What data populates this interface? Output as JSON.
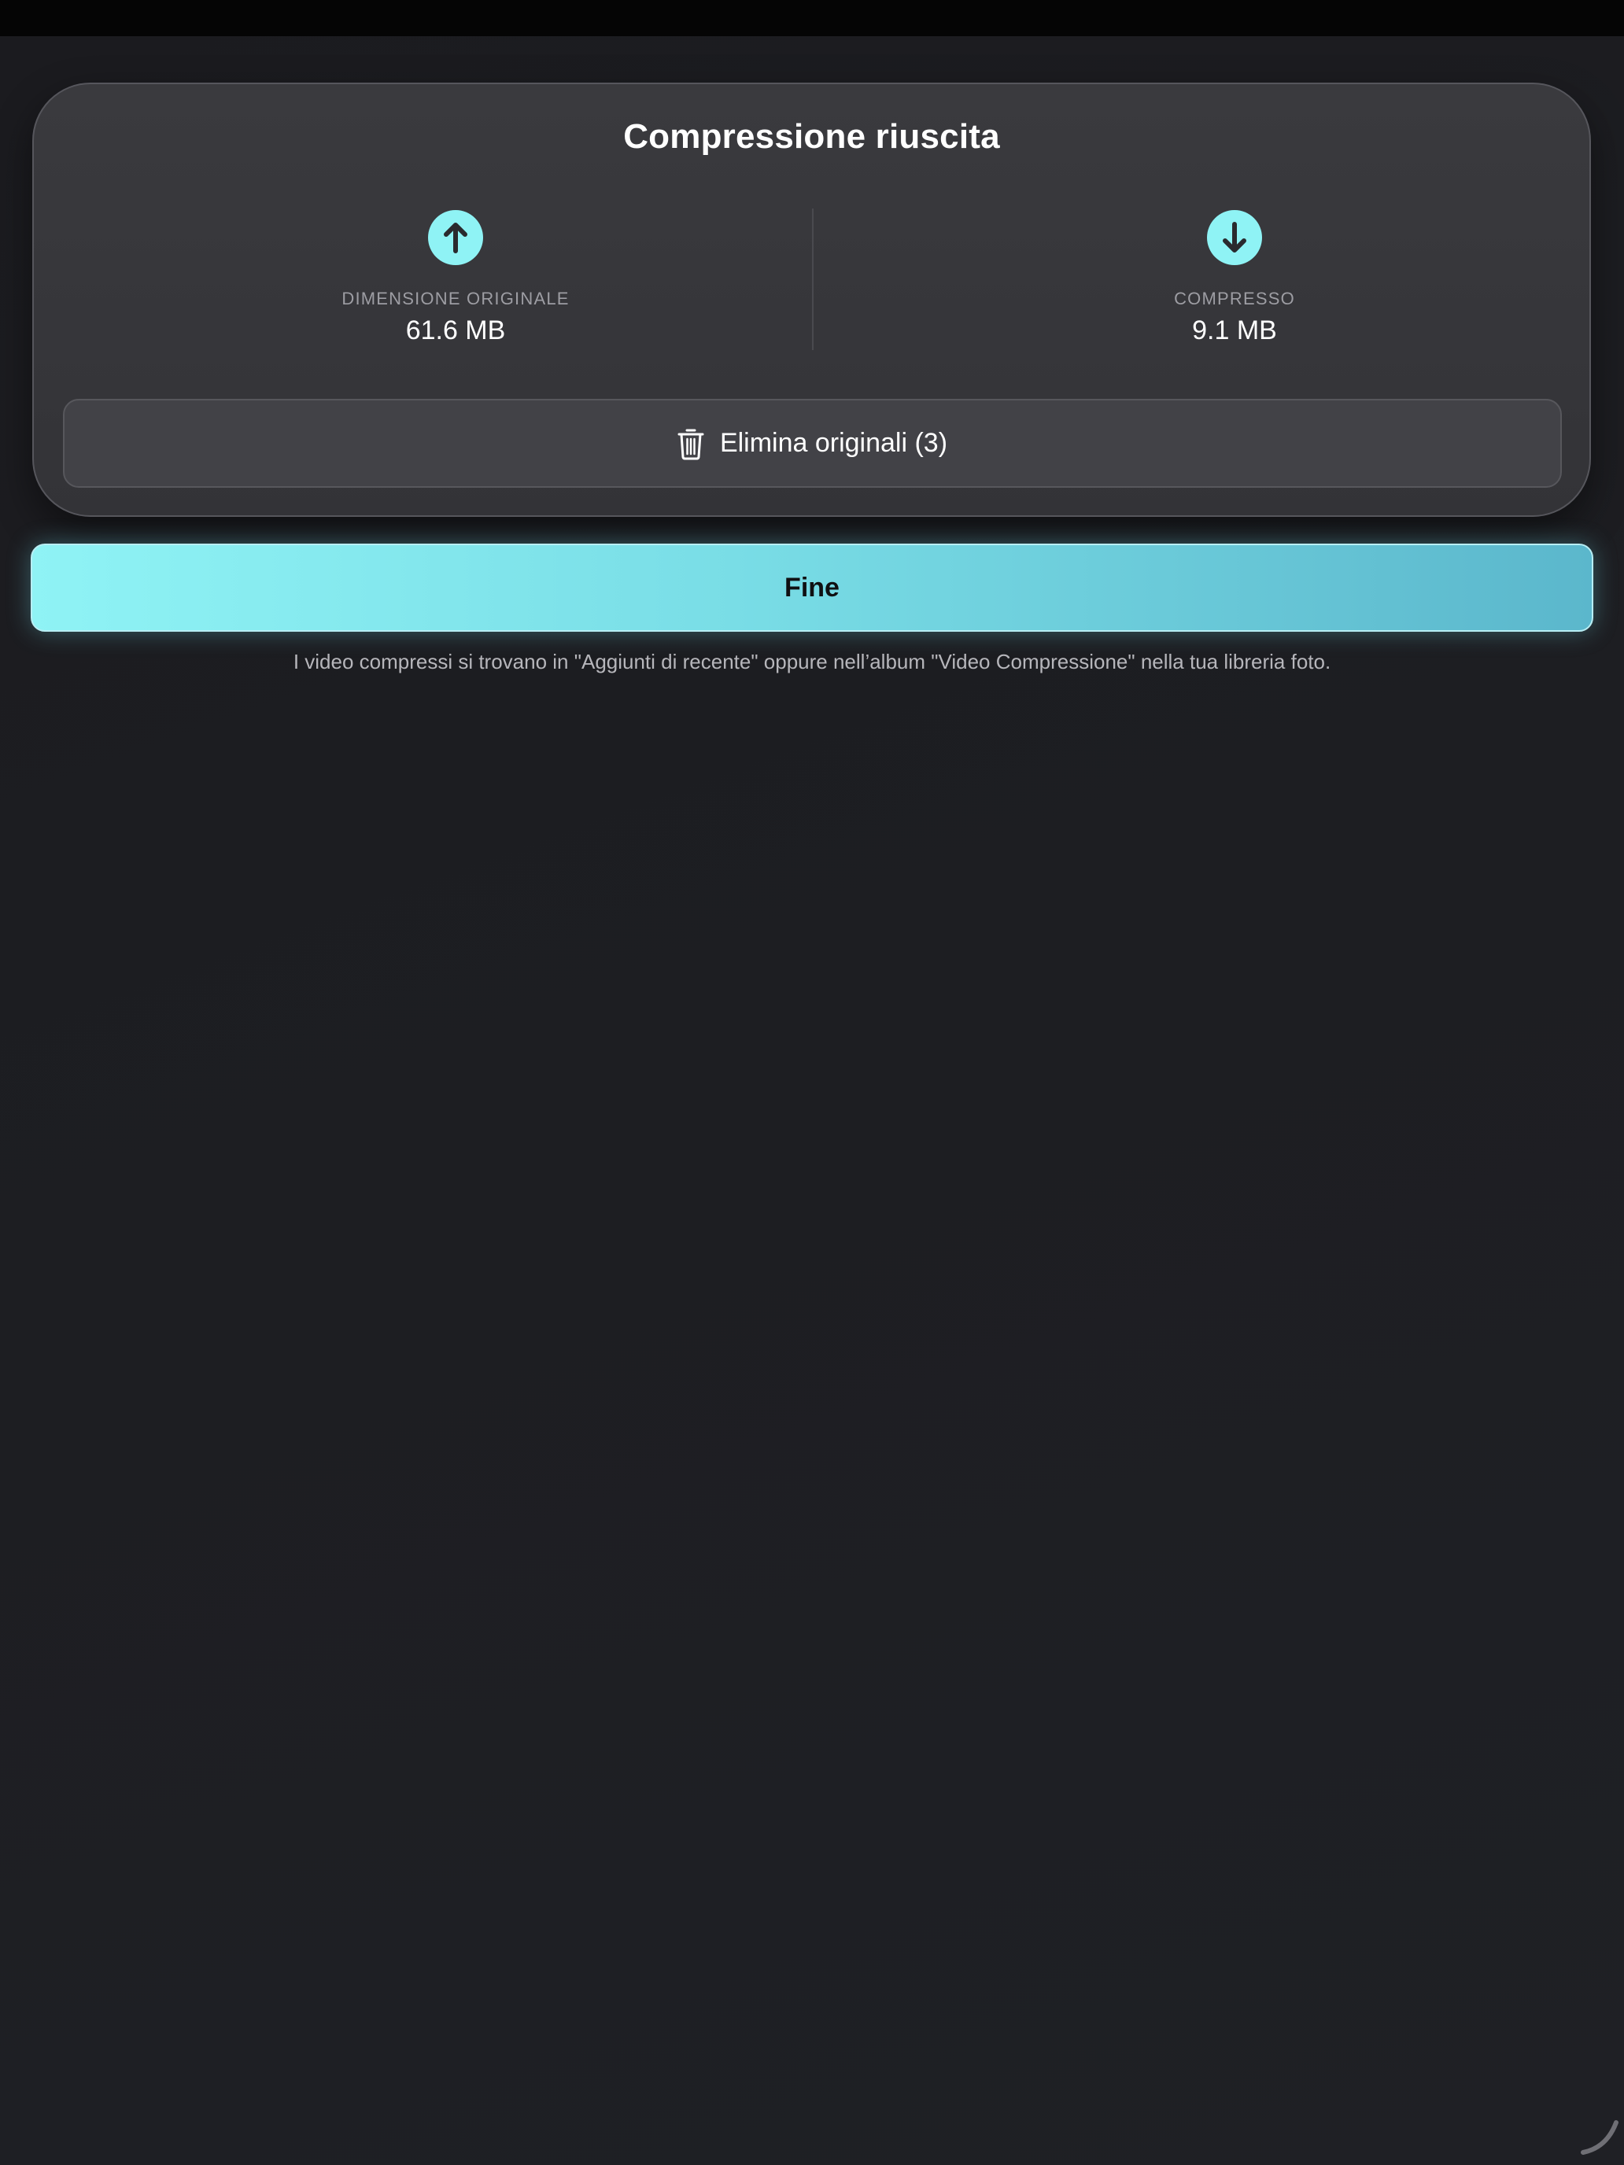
{
  "card": {
    "title": "Compressione riuscita",
    "original": {
      "label": "DIMENSIONE ORIGINALE",
      "value": "61.6 MB",
      "icon": "arrow-up-circle-icon"
    },
    "compressed": {
      "label": "COMPRESSO",
      "value": "9.1 MB",
      "icon": "arrow-down-circle-icon"
    },
    "delete_button": {
      "label": "Elimina originali (3)",
      "icon": "trash-icon"
    }
  },
  "done_button": {
    "label": "Fine"
  },
  "footnote": "I video compressi si trovano in \"Aggiunti di recente\" oppure nell’album \"Video Compressione\" nella tua libreria foto.",
  "colors": {
    "accent": "#8ff3f5",
    "accent_dark": "#5bb7cc",
    "background": "#1d1e22",
    "card": "#38383c"
  }
}
